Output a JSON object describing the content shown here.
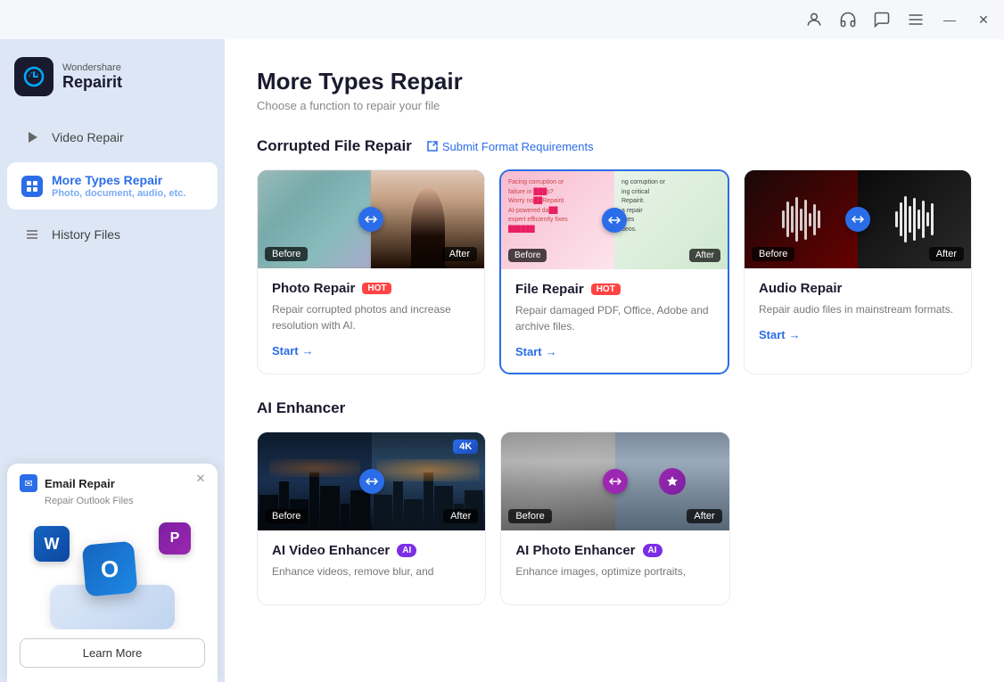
{
  "app": {
    "name": "Repairit",
    "brand": "Wondershare",
    "logo_char": "↺"
  },
  "titlebar": {
    "account_icon": "👤",
    "headset_icon": "🎧",
    "chat_icon": "💬",
    "menu_icon": "☰",
    "minimize_label": "—",
    "close_label": "✕"
  },
  "sidebar": {
    "nav_items": [
      {
        "id": "video-repair",
        "label": "Video Repair",
        "sub": "",
        "active": false,
        "icon": "▶"
      },
      {
        "id": "more-types-repair",
        "label": "More Types Repair",
        "sub": "Photo, document, audio, etc.",
        "active": true,
        "icon": "◈"
      },
      {
        "id": "history-files",
        "label": "History Files",
        "sub": "",
        "active": false,
        "icon": "☰"
      }
    ]
  },
  "promo": {
    "title": "Email Repair",
    "sub": "Repair Outlook Files",
    "word_icon": "W",
    "outlook_icon": "O",
    "pp_icon": "P",
    "learn_more": "Learn More"
  },
  "main": {
    "title": "More Types Repair",
    "subtitle": "Choose a function to repair your file",
    "section1": {
      "label": "Corrupted File Repair",
      "submit_link": "Submit Format Requirements"
    },
    "cards": [
      {
        "id": "photo-repair",
        "title": "Photo Repair",
        "badge": "HOT",
        "desc": "Repair corrupted photos and increase resolution with AI.",
        "link": "Start",
        "selected": false,
        "before_label": "Before",
        "after_label": "After"
      },
      {
        "id": "file-repair",
        "title": "File Repair",
        "badge": "HOT",
        "desc": "Repair damaged PDF, Office, Adobe and archive files.",
        "link": "Start",
        "selected": true,
        "before_label": "Before",
        "after_label": "After"
      },
      {
        "id": "audio-repair",
        "title": "Audio Repair",
        "badge": "",
        "desc": "Repair audio files in mainstream formats.",
        "link": "Start",
        "selected": false,
        "before_label": "Before",
        "after_label": "After"
      }
    ],
    "section2": {
      "label": "AI Enhancer"
    },
    "ai_cards": [
      {
        "id": "ai-video-enhancer",
        "title": "AI Video Enhancer",
        "ai_badge": "AI",
        "desc": "Enhance videos, remove blur, and",
        "badge_4k": "4K",
        "before_label": "Before",
        "after_label": "After"
      },
      {
        "id": "ai-photo-enhancer",
        "title": "AI Photo Enhancer",
        "ai_badge": "AI",
        "desc": "Enhance images, optimize portraits,",
        "before_label": "Before",
        "after_label": "After"
      }
    ]
  },
  "colors": {
    "accent": "#2b6de8",
    "hot": "#ff4444",
    "sidebar_bg": "#dce6f5",
    "active_nav": "#2b6de8"
  }
}
